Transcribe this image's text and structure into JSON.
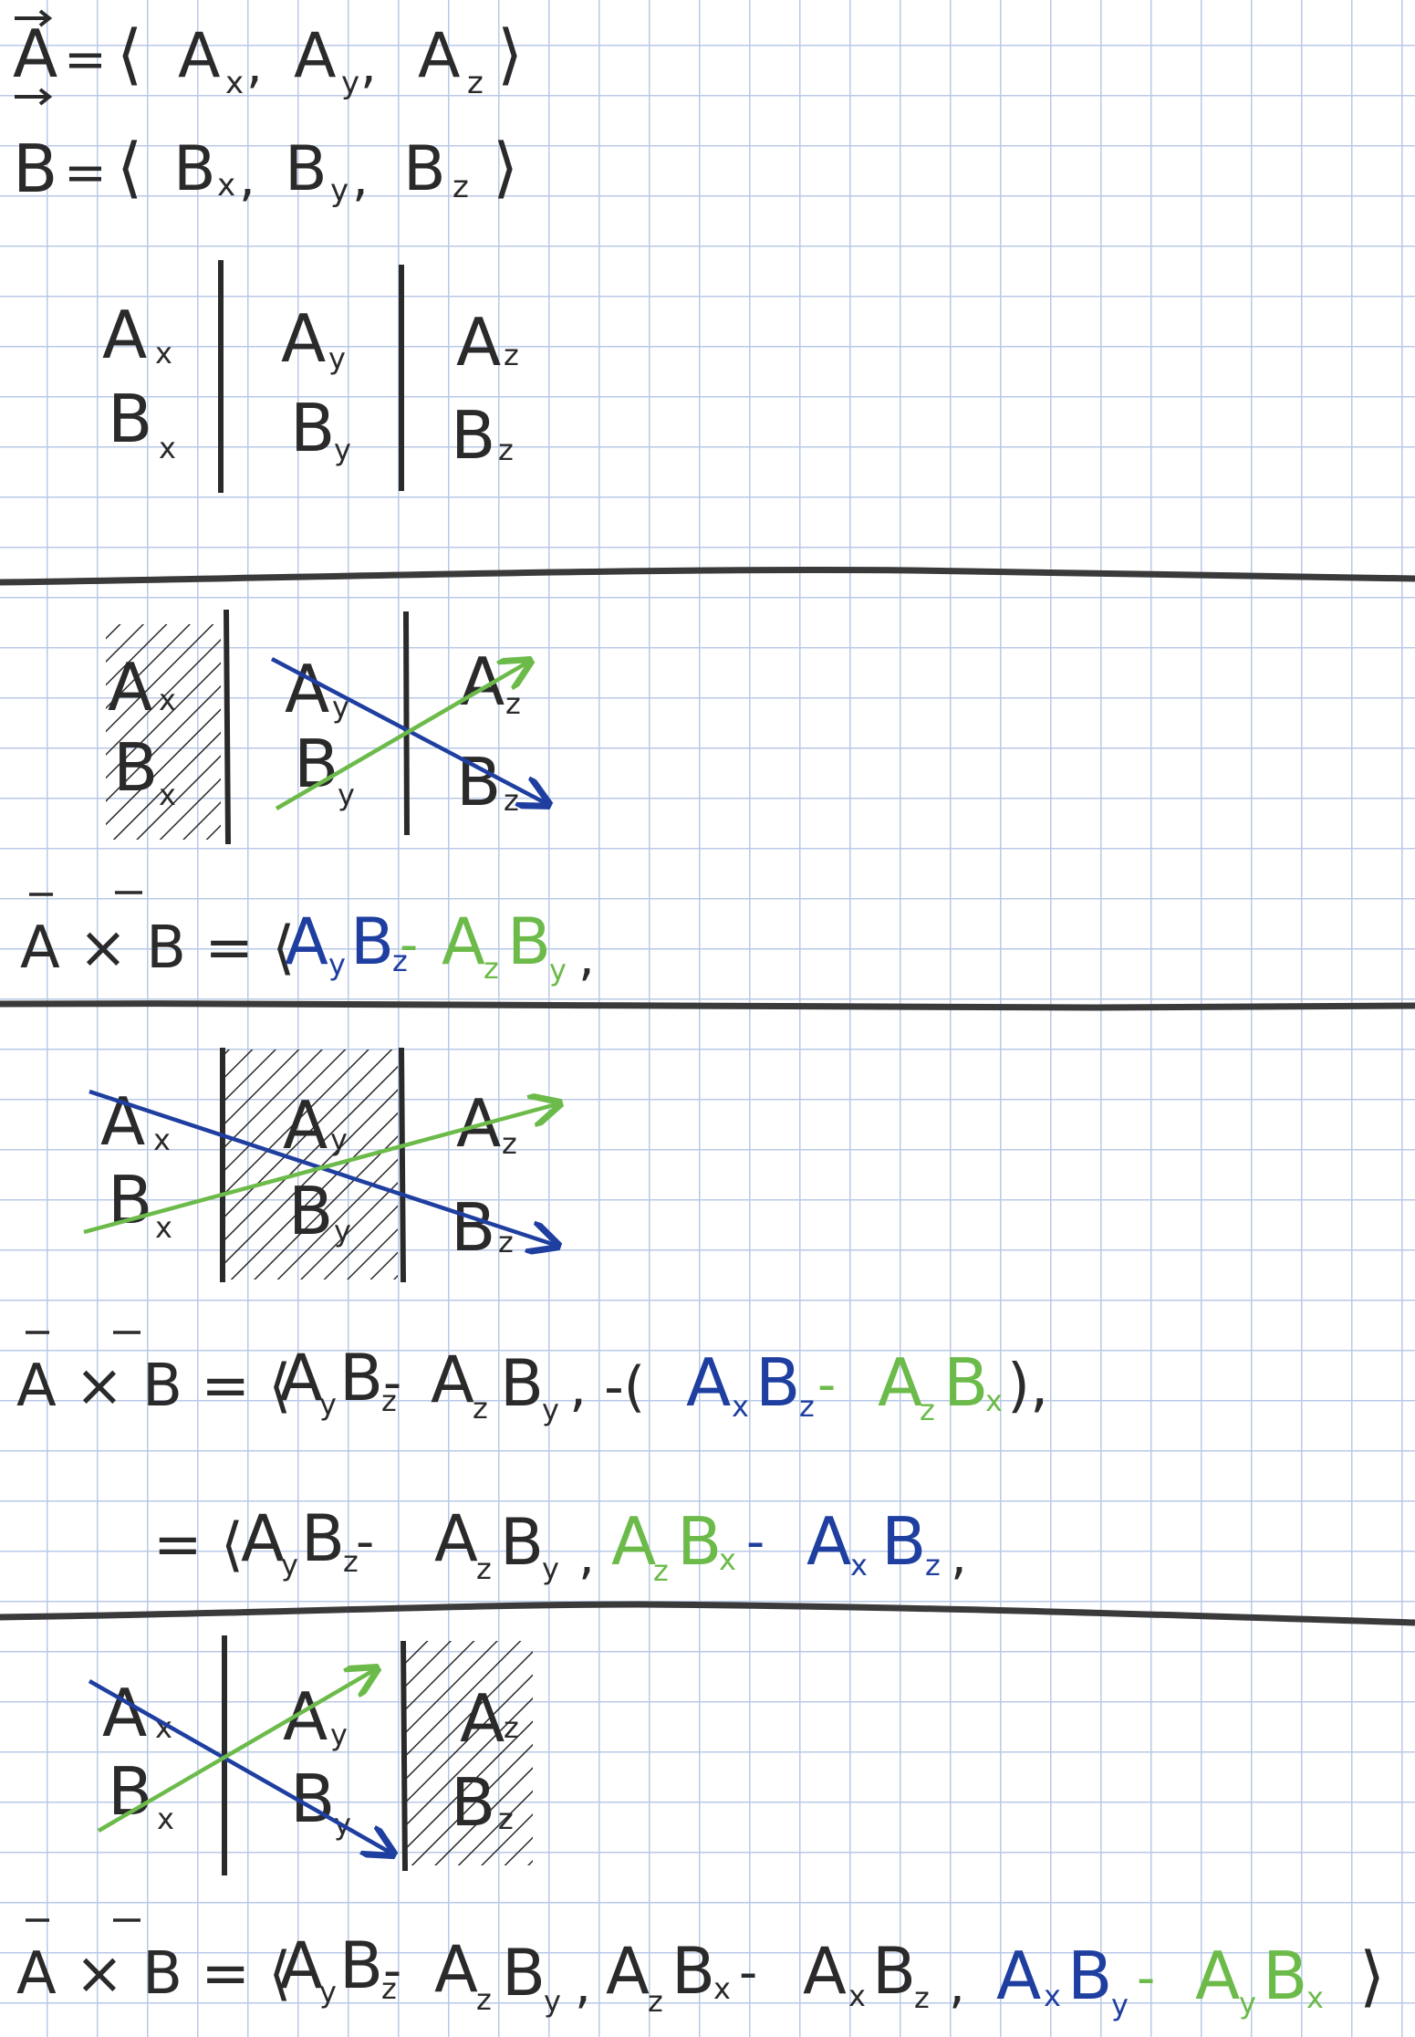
{
  "colors": {
    "ink": "#2a2a2a",
    "blue": "#1f3fa0",
    "green": "#6cbb4a",
    "grid": "#b9c9e6"
  },
  "definitions": {
    "a": [
      "A",
      " = ",
      "⟨",
      "A",
      "x",
      ", ",
      "A",
      "y",
      ", ",
      "A",
      "z",
      "⟩"
    ],
    "b": [
      "B",
      " = ",
      "⟨",
      "B",
      "x",
      ", ",
      "B",
      "y",
      ", ",
      "B",
      "z",
      "⟩"
    ]
  },
  "matrix": {
    "A": "A",
    "B": "B",
    "x": "x",
    "y": "y",
    "z": "z"
  },
  "step1": {
    "lhs": "A × B = ⟨",
    "t1": "A",
    "t1s": "y",
    "t2": "B",
    "t2s": "z",
    "minus": " - ",
    "t3": "A",
    "t3s": "z",
    "t4": "B",
    "t4s": "y",
    "tail": ","
  },
  "step2": {
    "lhs": "A × B = ⟨",
    "first": "A",
    "firsts": "y",
    "first2": "B",
    "first2s": "z",
    "m1": " - ",
    "first3": "A",
    "first3s": "z",
    "first4": "B",
    "first4s": "y",
    "sep": ", -(",
    "b1": "A",
    "b1s": "x",
    "b2": "B",
    "b2s": "z",
    "m2": " - ",
    "g1": "A",
    "g1s": "z",
    "g2": "B",
    "g2s": "x",
    "close": "),",
    "eq": "= ⟨",
    "r1": "A",
    "r1s": "y",
    "r2": "B",
    "r2s": "z",
    "rm1": " - ",
    "r3": "A",
    "r3s": "z",
    "r4": "B",
    "r4s": "y",
    "rsep": ",",
    "rg1": "A",
    "rg1s": "z",
    "rg2": "B",
    "rg2s": "x",
    "rm2": " - ",
    "rb1": "A",
    "rb1s": "x",
    "rb2": "B",
    "rb2s": "z",
    "rtail": ","
  },
  "step3": {
    "lhs": "A × B = ⟨",
    "p1": "A",
    "p1s": "y",
    "p2": "B",
    "p2s": "z",
    "m1": " - ",
    "p3": "A",
    "p3s": "z",
    "p4": "B",
    "p4s": "y",
    "sep1": ",",
    "q1": "A",
    "q1s": "z",
    "q2": "B",
    "q2s": "x",
    "m2": " - ",
    "q3": "A",
    "q3s": "x",
    "q4": "B",
    "q4s": "z",
    "sep2": ",",
    "b1": "A",
    "b1s": "x",
    "b2": "B",
    "b2s": "y",
    "m3": " - ",
    "g1": "A",
    "g1s": "y",
    "g2": "B",
    "g2s": "x",
    "close": "⟩"
  }
}
